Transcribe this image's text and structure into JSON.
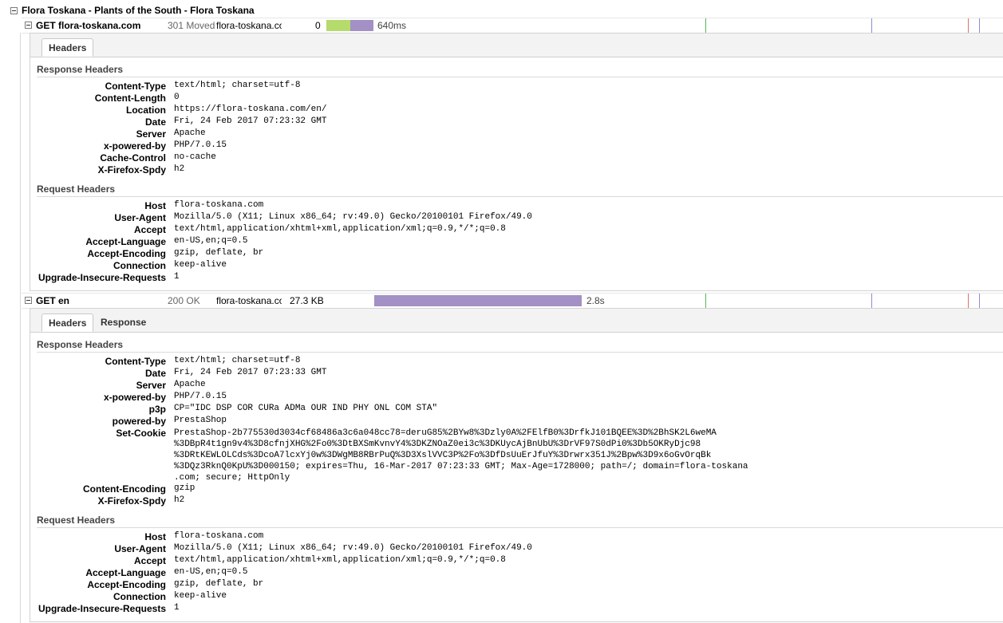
{
  "page": {
    "title": "Flora Toskana - Plants of the South - Flora Toskana"
  },
  "requests": [
    {
      "method": "GET flora-toskana.com",
      "status": "301 Moved",
      "domain": "flora-toskana.com",
      "size": "0",
      "time": "640ms",
      "tabs": [
        "Headers"
      ],
      "response_title": "Response Headers",
      "response_headers": [
        {
          "name": "Content-Type",
          "value": "text/html; charset=utf-8"
        },
        {
          "name": "Content-Length",
          "value": "0"
        },
        {
          "name": "Location",
          "value": "https://flora-toskana.com/en/"
        },
        {
          "name": "Date",
          "value": "Fri, 24 Feb 2017 07:23:32 GMT"
        },
        {
          "name": "Server",
          "value": "Apache"
        },
        {
          "name": "x-powered-by",
          "value": "PHP/7.0.15"
        },
        {
          "name": "Cache-Control",
          "value": "no-cache"
        },
        {
          "name": "X-Firefox-Spdy",
          "value": "h2"
        }
      ],
      "request_title": "Request Headers",
      "request_headers": [
        {
          "name": "Host",
          "value": "flora-toskana.com"
        },
        {
          "name": "User-Agent",
          "value": "Mozilla/5.0 (X11; Linux x86_64; rv:49.0) Gecko/20100101 Firefox/49.0"
        },
        {
          "name": "Accept",
          "value": "text/html,application/xhtml+xml,application/xml;q=0.9,*/*;q=0.8"
        },
        {
          "name": "Accept-Language",
          "value": "en-US,en;q=0.5"
        },
        {
          "name": "Accept-Encoding",
          "value": "gzip, deflate, br"
        },
        {
          "name": "Connection",
          "value": "keep-alive"
        },
        {
          "name": "Upgrade-Insecure-Requests",
          "value": "1"
        }
      ]
    },
    {
      "method": "GET en",
      "status": "200 OK",
      "domain": "flora-toskana.com",
      "size": "27.3 KB",
      "time": "2.8s",
      "tabs": [
        "Headers",
        "Response"
      ],
      "response_title": "Response Headers",
      "response_headers": [
        {
          "name": "Content-Type",
          "value": "text/html; charset=utf-8"
        },
        {
          "name": "Date",
          "value": "Fri, 24 Feb 2017 07:23:33 GMT"
        },
        {
          "name": "Server",
          "value": "Apache"
        },
        {
          "name": "x-powered-by",
          "value": "PHP/7.0.15"
        },
        {
          "name": "p3p",
          "value": "CP=\"IDC DSP COR CURa ADMa OUR IND PHY ONL COM STA\""
        },
        {
          "name": "powered-by",
          "value": "PrestaShop"
        },
        {
          "name": "Set-Cookie",
          "value": "PrestaShop-2b775530d3034cf68486a3c6a048cc78=deruG85%2BYw8%3Dzly0A%2FElfB0%3DrfkJ101BQEE%3D%2BhSK2L6weMA\n%3DBpR4t1gn9v4%3D8cfnjXHG%2Fo0%3DtBXSmKvnvY4%3DKZNOaZ0ei3c%3DKUycAjBnUbU%3DrVF97S0dPi0%3Db5OKRyDjc98\n%3DRtKEWLOLCds%3DcoA7lcxYj0w%3DWgMB8RBrPuQ%3D3XslVVC3P%2Fo%3DfDsUuErJfuY%3Drwrx351J%2Bpw%3D9x6oGvOrqBk\n%3DQz3RknQ0KpU%3D000150; expires=Thu, 16-Mar-2017 07:23:33 GMT; Max-Age=1728000; path=/; domain=flora-toskana\n.com; secure; HttpOnly"
        },
        {
          "name": "Content-Encoding",
          "value": "gzip"
        },
        {
          "name": "X-Firefox-Spdy",
          "value": "h2"
        }
      ],
      "request_title": "Request Headers",
      "request_headers": [
        {
          "name": "Host",
          "value": "flora-toskana.com"
        },
        {
          "name": "User-Agent",
          "value": "Mozilla/5.0 (X11; Linux x86_64; rv:49.0) Gecko/20100101 Firefox/49.0"
        },
        {
          "name": "Accept",
          "value": "text/html,application/xhtml+xml,application/xml;q=0.9,*/*;q=0.8"
        },
        {
          "name": "Accept-Language",
          "value": "en-US,en;q=0.5"
        },
        {
          "name": "Accept-Encoding",
          "value": "gzip, deflate, br"
        },
        {
          "name": "Connection",
          "value": "keep-alive"
        },
        {
          "name": "Upgrade-Insecure-Requests",
          "value": "1"
        }
      ]
    }
  ],
  "colors": {
    "waiting_bar": "#b5db6d",
    "receiving_bar": "#a390c4",
    "dom_line": "#5ab35a",
    "load_line": "#8c8cd9",
    "red_line": "#e07070"
  }
}
